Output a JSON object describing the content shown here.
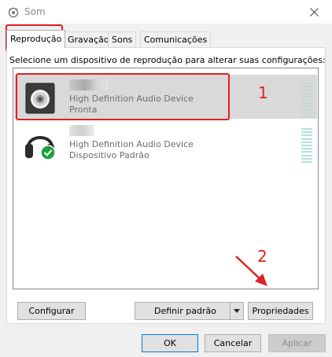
{
  "window": {
    "title": "Som",
    "icons": {
      "app": "speaker-settings-icon",
      "close": "close-icon"
    }
  },
  "tabs": [
    {
      "label": "Reprodução"
    },
    {
      "label": "Gravação"
    },
    {
      "label": "Sons"
    },
    {
      "label": "Comunicações"
    }
  ],
  "instruction": "Selecione um dispositivo de reprodução para alterar suas configurações:",
  "devices": [
    {
      "description": "High Definition Audio Device",
      "status": "Pronta",
      "icon": "speaker-icon"
    },
    {
      "description": "High Definition Audio Device",
      "status": "Dispositivo Padrão",
      "icon": "headphones-icon"
    }
  ],
  "annotations": {
    "one": "1",
    "two": "2"
  },
  "buttons": {
    "configure": "Configurar",
    "set_default": "Definir padrão",
    "properties": "Propriedades",
    "ok": "OK",
    "cancel": "Cancelar",
    "apply": "Aplicar"
  },
  "colors": {
    "annotation": "#e02020",
    "selection": "#d9d9d9",
    "check": "#1a9f3c"
  }
}
